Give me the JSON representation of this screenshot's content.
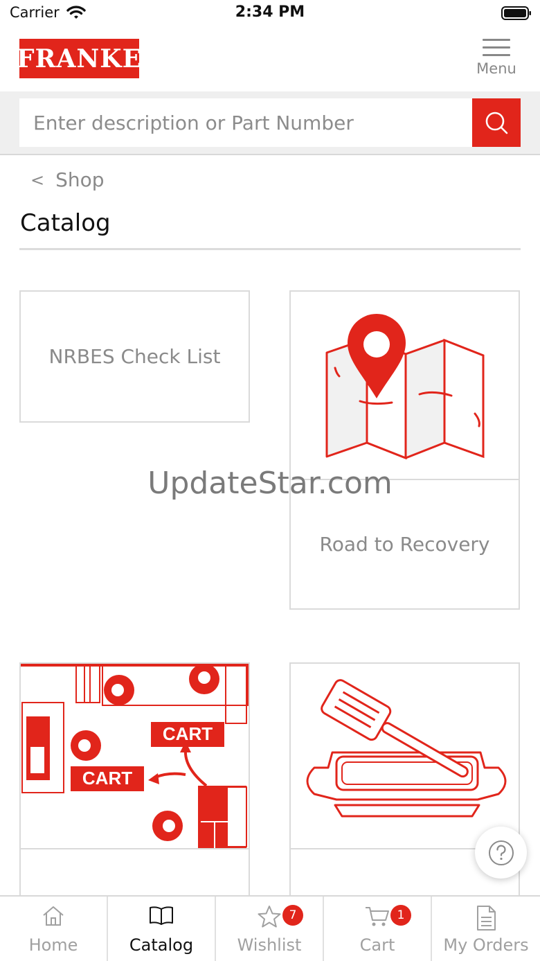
{
  "status_bar": {
    "carrier": "Carrier",
    "time": "2:34 PM"
  },
  "header": {
    "logo_text": "FRANKE",
    "menu_label": "Menu"
  },
  "search": {
    "placeholder": "Enter description or Part Number",
    "icon": "search-icon"
  },
  "breadcrumb": {
    "back_label": "Shop"
  },
  "page": {
    "title": "Catalog"
  },
  "tiles": [
    {
      "label": "NRBES Check List",
      "image": ""
    },
    {
      "label": "Road to Recovery",
      "image": "map-pin-illustration"
    },
    {
      "label": "",
      "image": "cart-floorplan-illustration",
      "image_text": "CART"
    },
    {
      "label": "",
      "image": "baking-dish-spatula-illustration"
    }
  ],
  "watermark": "UpdateStar.com",
  "help": {
    "icon": "help-icon"
  },
  "tab_bar": {
    "tabs": [
      {
        "label": "Home",
        "icon": "home-icon",
        "active": false
      },
      {
        "label": "Catalog",
        "icon": "book-icon",
        "active": true
      },
      {
        "label": "Wishlist",
        "icon": "star-icon",
        "badge": "7",
        "active": false
      },
      {
        "label": "Cart",
        "icon": "cart-icon",
        "badge": "1",
        "active": false
      },
      {
        "label": "My Orders",
        "icon": "document-icon",
        "active": false
      }
    ]
  },
  "colors": {
    "brand": "#e1251b",
    "muted_text": "#8a8a8a",
    "border": "#dadada"
  }
}
